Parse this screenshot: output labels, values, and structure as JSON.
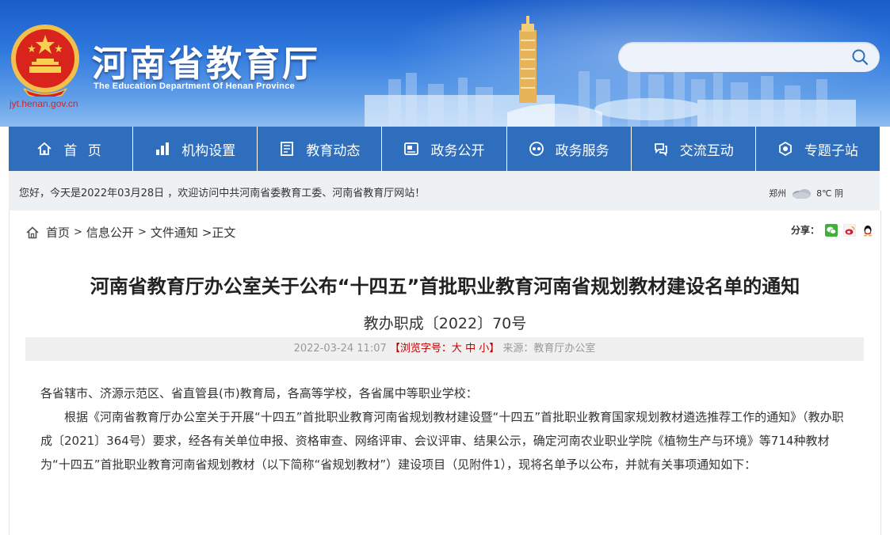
{
  "header": {
    "title": "河南省教育厅",
    "subtitle": "The Education Department Of Henan Province",
    "url_text": "jyt.henan.gov.cn",
    "search_placeholder": ""
  },
  "nav": {
    "items": [
      {
        "label": "首 页",
        "icon": "home-icon"
      },
      {
        "label": "机构设置",
        "icon": "org-chart-icon"
      },
      {
        "label": "教育动态",
        "icon": "news-icon"
      },
      {
        "label": "政务公开",
        "icon": "document-icon"
      },
      {
        "label": "政务服务",
        "icon": "service-icon"
      },
      {
        "label": "交流互动",
        "icon": "interaction-icon"
      },
      {
        "label": "专题子站",
        "icon": "topic-icon"
      }
    ]
  },
  "welcome": {
    "text": "您好，今天是2022年03月28日 ，欢迎访问中共河南省委教育工委、河南省教育厅网站！",
    "weather_city": "郑州",
    "weather_temp": "8℃ 阴",
    "weather_icon": "cloudy-icon"
  },
  "breadcrumb": {
    "home": "首页",
    "sep": ">",
    "items": [
      "信息公开",
      "文件通知"
    ],
    "current": ">正文"
  },
  "share": {
    "label": "分享：",
    "icons": [
      "wechat-icon",
      "weibo-icon",
      "qq-icon"
    ]
  },
  "article": {
    "title": "河南省教育厅办公室关于公布“十四五”首批职业教育河南省规划教材建设名单的通知",
    "doc_no": "教办职成〔2022〕70号",
    "date": "2022-03-24 11:07",
    "font_size_label": "【浏览字号：",
    "font_large": "大",
    "font_medium": "中",
    "font_small": "小",
    "font_size_close": "】",
    "source": "来源：教育厅办公室",
    "salutation": "各省辖市、济源示范区、省直管县(市)教育局，各高等学校，各省属中等职业学校：",
    "para1": "根据《河南省教育厅办公室关于开展“十四五”首批职业教育河南省规划教材建设暨“十四五”首批职业教育国家规划教材遴选推荐工作的通知》（教办职成〔2021〕364号）要求，经各有关单位申报、资格审查、网络评审、会议评审、结果公示，确定河南农业职业学院《植物生产与环境》等714种教材为“十四五”首批职业教育河南省规划教材（以下简称“省规划教材”）建设项目（见附件1），现将名单予以公布，并就有关事项通知如下："
  },
  "colors": {
    "nav": "#2f6ebd",
    "accent_red": "#c00000",
    "url_red": "#d7261f"
  }
}
